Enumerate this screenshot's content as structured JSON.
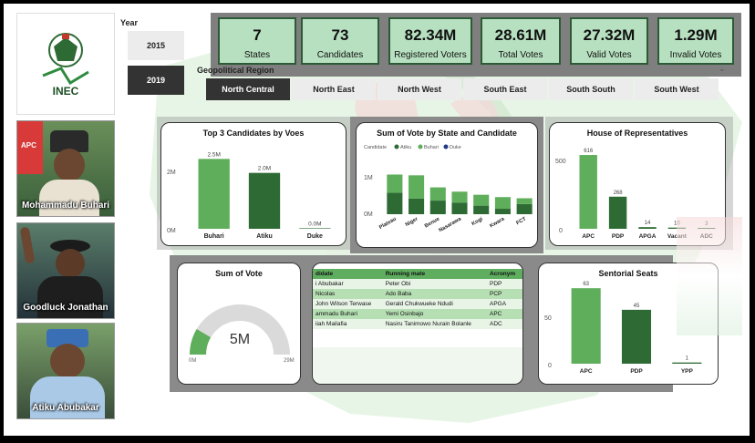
{
  "sidebar": {
    "logo_text": "INEC",
    "portraits": [
      {
        "name": "Mohammadu Buhari",
        "badge": "APC"
      },
      {
        "name": "Goodluck Jonathan",
        "badge": ""
      },
      {
        "name": "Atiku Abubakar",
        "badge": ""
      }
    ]
  },
  "year_slicer": {
    "label": "Year",
    "options": [
      "2015",
      "2019"
    ],
    "selected": "2019"
  },
  "kpis": [
    {
      "value": "7",
      "label": "States"
    },
    {
      "value": "73",
      "label": "Candidates"
    },
    {
      "value": "82.34M",
      "label": "Registered Voters"
    },
    {
      "value": "28.61M",
      "label": "Total Votes"
    },
    {
      "value": "27.32M",
      "label": "Valid Votes"
    },
    {
      "value": "1.29M",
      "label": "Invalid Votes"
    }
  ],
  "geo_slicer": {
    "label": "Geopolitical Region",
    "options": [
      "North Central",
      "North East",
      "North West",
      "South East",
      "South South",
      "South West"
    ],
    "selected": "North Central"
  },
  "colors": {
    "dark_green": "#2e6b34",
    "mid_green": "#5fae5b",
    "light_green": "#a9d8a3",
    "gauge_fill": "#5fae5b",
    "gauge_track": "#dadada"
  },
  "top3": {
    "title": "Top 3 Candidates by Voes",
    "yticks": [
      "2M",
      "0M"
    ]
  },
  "state_vote": {
    "title": "Sum of Vote by State and Candidate",
    "legend_title": "Candidate",
    "legend": [
      "Atiku",
      "Buhari",
      "Duke"
    ],
    "yticks": [
      "1M",
      "0M"
    ]
  },
  "house": {
    "title": "House of Representatives",
    "yticks": [
      "500",
      "0"
    ]
  },
  "gauge": {
    "title": "Sum of Vote",
    "value_label": "5M",
    "min_label": "0M",
    "max_label": "29M",
    "fraction": 0.17
  },
  "candidates_table": {
    "headers": [
      "didate",
      "Running mate",
      "Acronym"
    ],
    "rows": [
      [
        "i Abubakar",
        "Peter Obi",
        "PDP"
      ],
      [
        "Nicolas",
        "Ado Baba",
        "PCP"
      ],
      [
        "John Wilson Terwase",
        "Gerald Chukwueke Ndudi",
        "APGA"
      ],
      [
        "ammadu Buhari",
        "Yemi Osinbajo",
        "APC"
      ],
      [
        "iiah Mailafia",
        "Nasiru Tanimowo Nurain Bolanle",
        "ADC"
      ]
    ]
  },
  "senate": {
    "title": "Sentorial Seats",
    "yticks": [
      "50",
      "0"
    ]
  },
  "chart_data": [
    {
      "type": "bar",
      "title": "Top 3 Candidates by Voes",
      "categories": [
        "Buhari",
        "Atiku",
        "Duke"
      ],
      "values": [
        2.5,
        2.0,
        0.0
      ],
      "data_labels": [
        "2.5M",
        "2.0M",
        "0.0M"
      ],
      "ylabel": "",
      "xlabel": "",
      "ylim": [
        0,
        3
      ],
      "bar_colors": [
        "#5fae5b",
        "#2e6b34",
        "#2e6b34"
      ]
    },
    {
      "type": "bar",
      "stacked": true,
      "title": "Sum of Vote by State and Candidate",
      "categories": [
        "Plateau",
        "Niger",
        "Benue",
        "Nasarawa",
        "Kogi",
        "Kwara",
        "FCT"
      ],
      "series": [
        {
          "name": "Atiku",
          "values": [
            0.55,
            0.4,
            0.35,
            0.3,
            0.22,
            0.14,
            0.26
          ],
          "color": "#2e6b34"
        },
        {
          "name": "Buhari",
          "values": [
            0.47,
            0.6,
            0.34,
            0.28,
            0.28,
            0.3,
            0.15
          ],
          "color": "#5fae5b"
        },
        {
          "name": "Duke",
          "values": [
            0.0,
            0.0,
            0.0,
            0.0,
            0.0,
            0.0,
            0.0
          ],
          "color": "#1f3b8a"
        }
      ],
      "ylim": [
        0,
        1.5
      ]
    },
    {
      "type": "bar",
      "title": "House of Representatives",
      "categories": [
        "APC",
        "PDP",
        "APGA",
        "Vacant",
        "ADC"
      ],
      "values": [
        616,
        268,
        14,
        10,
        3
      ],
      "data_labels": [
        "616",
        "268",
        "14",
        "10",
        "3"
      ],
      "ylim": [
        0,
        700
      ],
      "bar_colors": [
        "#5fae5b",
        "#2e6b34",
        "#2e6b34",
        "#2e6b34",
        "#2e6b34"
      ]
    },
    {
      "type": "bar",
      "title": "Sentorial Seats",
      "categories": [
        "APC",
        "PDP",
        "YPP"
      ],
      "values": [
        63,
        45,
        1
      ],
      "data_labels": [
        "63",
        "45",
        "1"
      ],
      "ylim": [
        0,
        70
      ],
      "bar_colors": [
        "#5fae5b",
        "#2e6b34",
        "#2e6b34"
      ]
    }
  ]
}
